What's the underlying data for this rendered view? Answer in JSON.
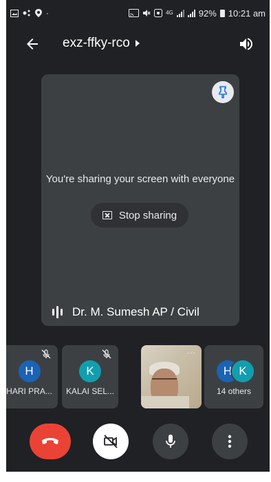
{
  "status_bar": {
    "battery": "92%",
    "time": "10:21 am",
    "network": "4G"
  },
  "app_bar": {
    "meeting_code": "exz-ffky-rco"
  },
  "stage": {
    "share_message": "You're sharing your screen with everyone",
    "stop_sharing_label": "Stop sharing",
    "presenter_name": "Dr. M. Sumesh AP / Civil"
  },
  "participants": [
    {
      "initial": "H",
      "name": "HARI PRA...",
      "muted": true,
      "color": "#1a63b5"
    },
    {
      "initial": "K",
      "name": "KALAI SEL...",
      "muted": true,
      "color": "#129eaf"
    },
    {
      "name": "",
      "video": true
    },
    {
      "initials": [
        "H",
        "K"
      ],
      "name": "14 others",
      "colors": [
        "#1a63b5",
        "#129eaf"
      ]
    }
  ],
  "colors": {
    "background": "#202124",
    "tile": "#3c4043",
    "hangup": "#ea4335"
  },
  "icons": {
    "back": "arrow-back-icon",
    "speaker": "volume-icon",
    "pin": "pin-icon",
    "stop": "stop-share-icon",
    "audio": "audio-level-icon",
    "mic_off": "mic-off-icon",
    "hangup": "call-end-icon",
    "cam_off": "videocam-off-icon",
    "mic": "mic-icon",
    "more": "more-vert-icon"
  }
}
